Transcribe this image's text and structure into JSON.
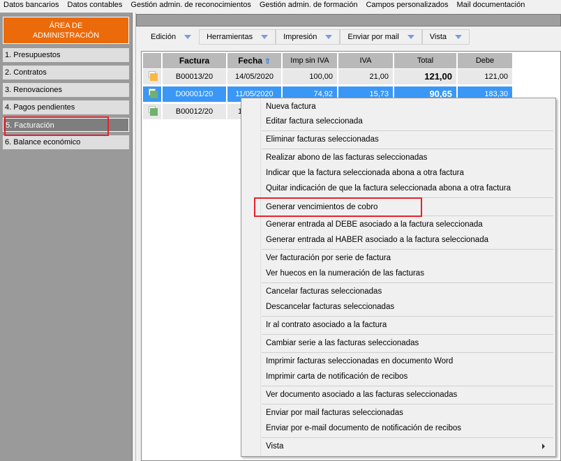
{
  "top_menu": [
    "Datos bancarios",
    "Datos contables",
    "Gestión admin. de reconocimientos",
    "Gestión admin. de formación",
    "Campos personalizados",
    "Mail documentación"
  ],
  "sidebar": {
    "title_line1": "ÁREA DE",
    "title_line2": "ADMINISTRACIÓN",
    "items": [
      "1. Presupuestos",
      "2. Contratos",
      "3. Renovaciones",
      "4. Pagos pendientes",
      "5. Facturación",
      "6. Balance económico"
    ],
    "active_index": 4
  },
  "toolbar": [
    "Edición",
    "Herramientas",
    "Impresión",
    "Enviar por mail",
    "Vista"
  ],
  "table": {
    "columns": [
      "Factura",
      "Fecha",
      "Imp sin IVA",
      "IVA",
      "Total",
      "Debe"
    ],
    "rows": [
      {
        "factura": "B00013/20",
        "fecha": "14/05/2020",
        "imp": "100,00",
        "iva": "21,00",
        "total": "121,00",
        "debe": "121,00",
        "color": "#f7b944",
        "selected": false
      },
      {
        "factura": "D00001/20",
        "fecha": "11/05/2020",
        "imp": "74,92",
        "iva": "15,73",
        "total": "90,65",
        "debe": "183,30",
        "color": "#6fb26f",
        "selected": true
      },
      {
        "factura": "B00012/20",
        "fecha": "1",
        "imp": "",
        "iva": "",
        "total": "",
        "debe": "",
        "color": "#6fb26f",
        "selected": false
      }
    ]
  },
  "context_menu": [
    "Nueva factura",
    "Editar factura seleccionada",
    "Eliminar facturas seleccionadas",
    "Realizar abono de las facturas seleccionadas",
    "Indicar que la factura seleccionada abona a otra factura",
    "Quitar indicación de que la factura seleccionada abona a otra factura",
    "Generar vencimientos de cobro",
    "Generar entrada al DEBE asociado a la factura seleccionada",
    "Generar entrada al HABER asociado a la factura seleccionada",
    "Ver facturación por serie de factura",
    "Ver huecos en la numeración de las facturas",
    "Cancelar facturas seleccionadas",
    "Descancelar facturas seleccionadas",
    "Ir al contrato asociado a la factura",
    "Cambiar serie a las facturas seleccionadas",
    "Imprimir facturas seleccionadas en documento Word",
    "Imprimir carta de notificación de recibos",
    "Ver documento asociado a las facturas seleccionadas",
    "Enviar por mail facturas seleccionadas",
    "Enviar por e-mail documento de notificación de recibos",
    "Vista"
  ],
  "highlight_color": "#e8202c"
}
